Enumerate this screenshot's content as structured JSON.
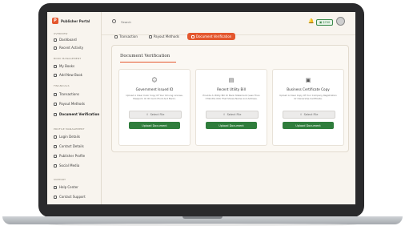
{
  "app": {
    "brand_name": "Publisher Portal",
    "brand_initial": "P"
  },
  "sidebar": {
    "sections": [
      {
        "title": "OVERVIEW",
        "items": [
          "Dashboard",
          "Recent Activity"
        ]
      },
      {
        "title": "BOOK MANAGEMENT",
        "items": [
          "My Books",
          "Add New Book"
        ]
      },
      {
        "title": "FINANCIALS",
        "items": [
          "Transactions",
          "Payout Methods",
          "Document Verification"
        ]
      },
      {
        "title": "PROFILE MANAGEMENT",
        "items": [
          "Login Details",
          "Contact Details",
          "Publisher Profile",
          "Social Media"
        ]
      },
      {
        "title": "SUPPORT",
        "items": [
          "Help Center",
          "Contact Support"
        ]
      }
    ],
    "active_item": "Document Verification"
  },
  "topbar": {
    "search_placeholder": "Search",
    "balance": "$700"
  },
  "tabs": [
    {
      "label": "Transaction",
      "icon": "dollar-icon",
      "active": false
    },
    {
      "label": "Payout Methods",
      "icon": "wallet-icon",
      "active": false
    },
    {
      "label": "Document Verification",
      "icon": "document-icon",
      "active": true
    }
  ],
  "panel": {
    "title": "Document Verification",
    "cards": [
      {
        "icon": "user-check-icon",
        "title": "Government Issued ID",
        "desc": "Upload A Clear Color Copy Of Your Driving License, Passport, Or ID Card (Front And Back).",
        "select": "Select File",
        "upload": "Upload Document"
      },
      {
        "icon": "bill-icon",
        "title": "Recent Utility Bill",
        "desc": "Provide A Utility Bill Or Bank Statement (Less Than 3 Months Old) That Shows Name And Address.",
        "select": "Select File",
        "upload": "Upload Document"
      },
      {
        "icon": "certificate-icon",
        "title": "Business Certificate Copy",
        "desc": "Upload A Clear Copy Of Your Company Registration Or Ownership Certificate.",
        "select": "Select File",
        "upload": "Upload Document"
      }
    ]
  },
  "colors": {
    "accent": "#e4572e",
    "success": "#2f7d3c",
    "background": "#f8f4ee",
    "frame": "#2a2a2c"
  }
}
